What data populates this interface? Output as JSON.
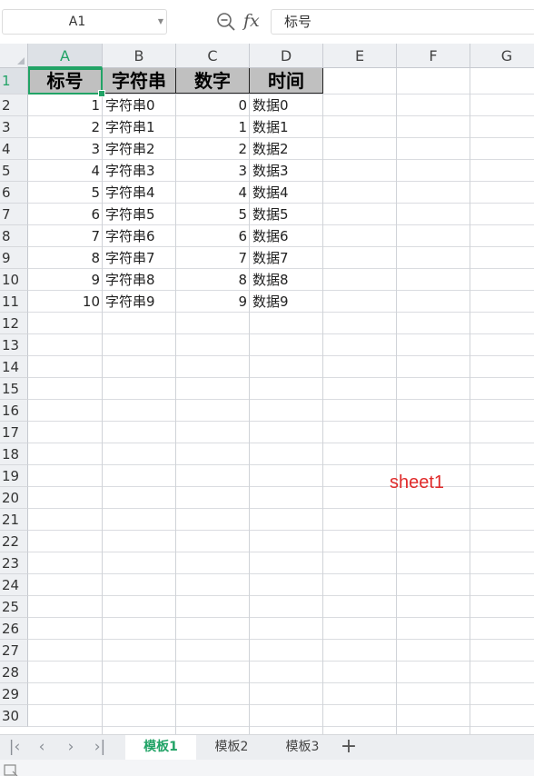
{
  "formula_bar": {
    "name_box": "A1",
    "fx_label": "fx",
    "content": "标号",
    "icons": [
      "zoom-icon",
      "fx-icon",
      "dropdown-caret-icon"
    ]
  },
  "columns": [
    "A",
    "B",
    "C",
    "D",
    "E",
    "F",
    "G"
  ],
  "rows": [
    "1",
    "2",
    "3",
    "4",
    "5",
    "6",
    "7",
    "8",
    "9",
    "10",
    "11",
    "12",
    "13",
    "14",
    "15",
    "16",
    "17",
    "18",
    "19",
    "20",
    "21",
    "22",
    "23",
    "24",
    "25",
    "26",
    "27",
    "28",
    "29",
    "30"
  ],
  "table": {
    "headers": [
      "标号",
      "字符串",
      "数字",
      "时间"
    ],
    "rows": [
      [
        "1",
        "字符串0",
        "0",
        "数据0"
      ],
      [
        "2",
        "字符串1",
        "1",
        "数据1"
      ],
      [
        "3",
        "字符串2",
        "2",
        "数据2"
      ],
      [
        "4",
        "字符串3",
        "3",
        "数据3"
      ],
      [
        "5",
        "字符串4",
        "4",
        "数据4"
      ],
      [
        "6",
        "字符串5",
        "5",
        "数据5"
      ],
      [
        "7",
        "字符串6",
        "6",
        "数据6"
      ],
      [
        "8",
        "字符串7",
        "7",
        "数据7"
      ],
      [
        "9",
        "字符串8",
        "8",
        "数据8"
      ],
      [
        "10",
        "字符串9",
        "9",
        "数据9"
      ]
    ]
  },
  "selection": {
    "cell": "A1"
  },
  "watermark": {
    "text": "sheet1",
    "color": "#e02a2a"
  },
  "sheet_tabs": {
    "active": 0,
    "tabs": [
      "模板1",
      "模板2",
      "模板3"
    ],
    "nav_icons": [
      "first-sheet-icon",
      "prev-sheet-icon",
      "next-sheet-icon",
      "last-sheet-icon"
    ],
    "add_icon": "add-sheet-icon"
  },
  "colors": {
    "accent": "#21a366",
    "header_fill": "#c0c0c0",
    "grid_line": "#dadce0"
  }
}
